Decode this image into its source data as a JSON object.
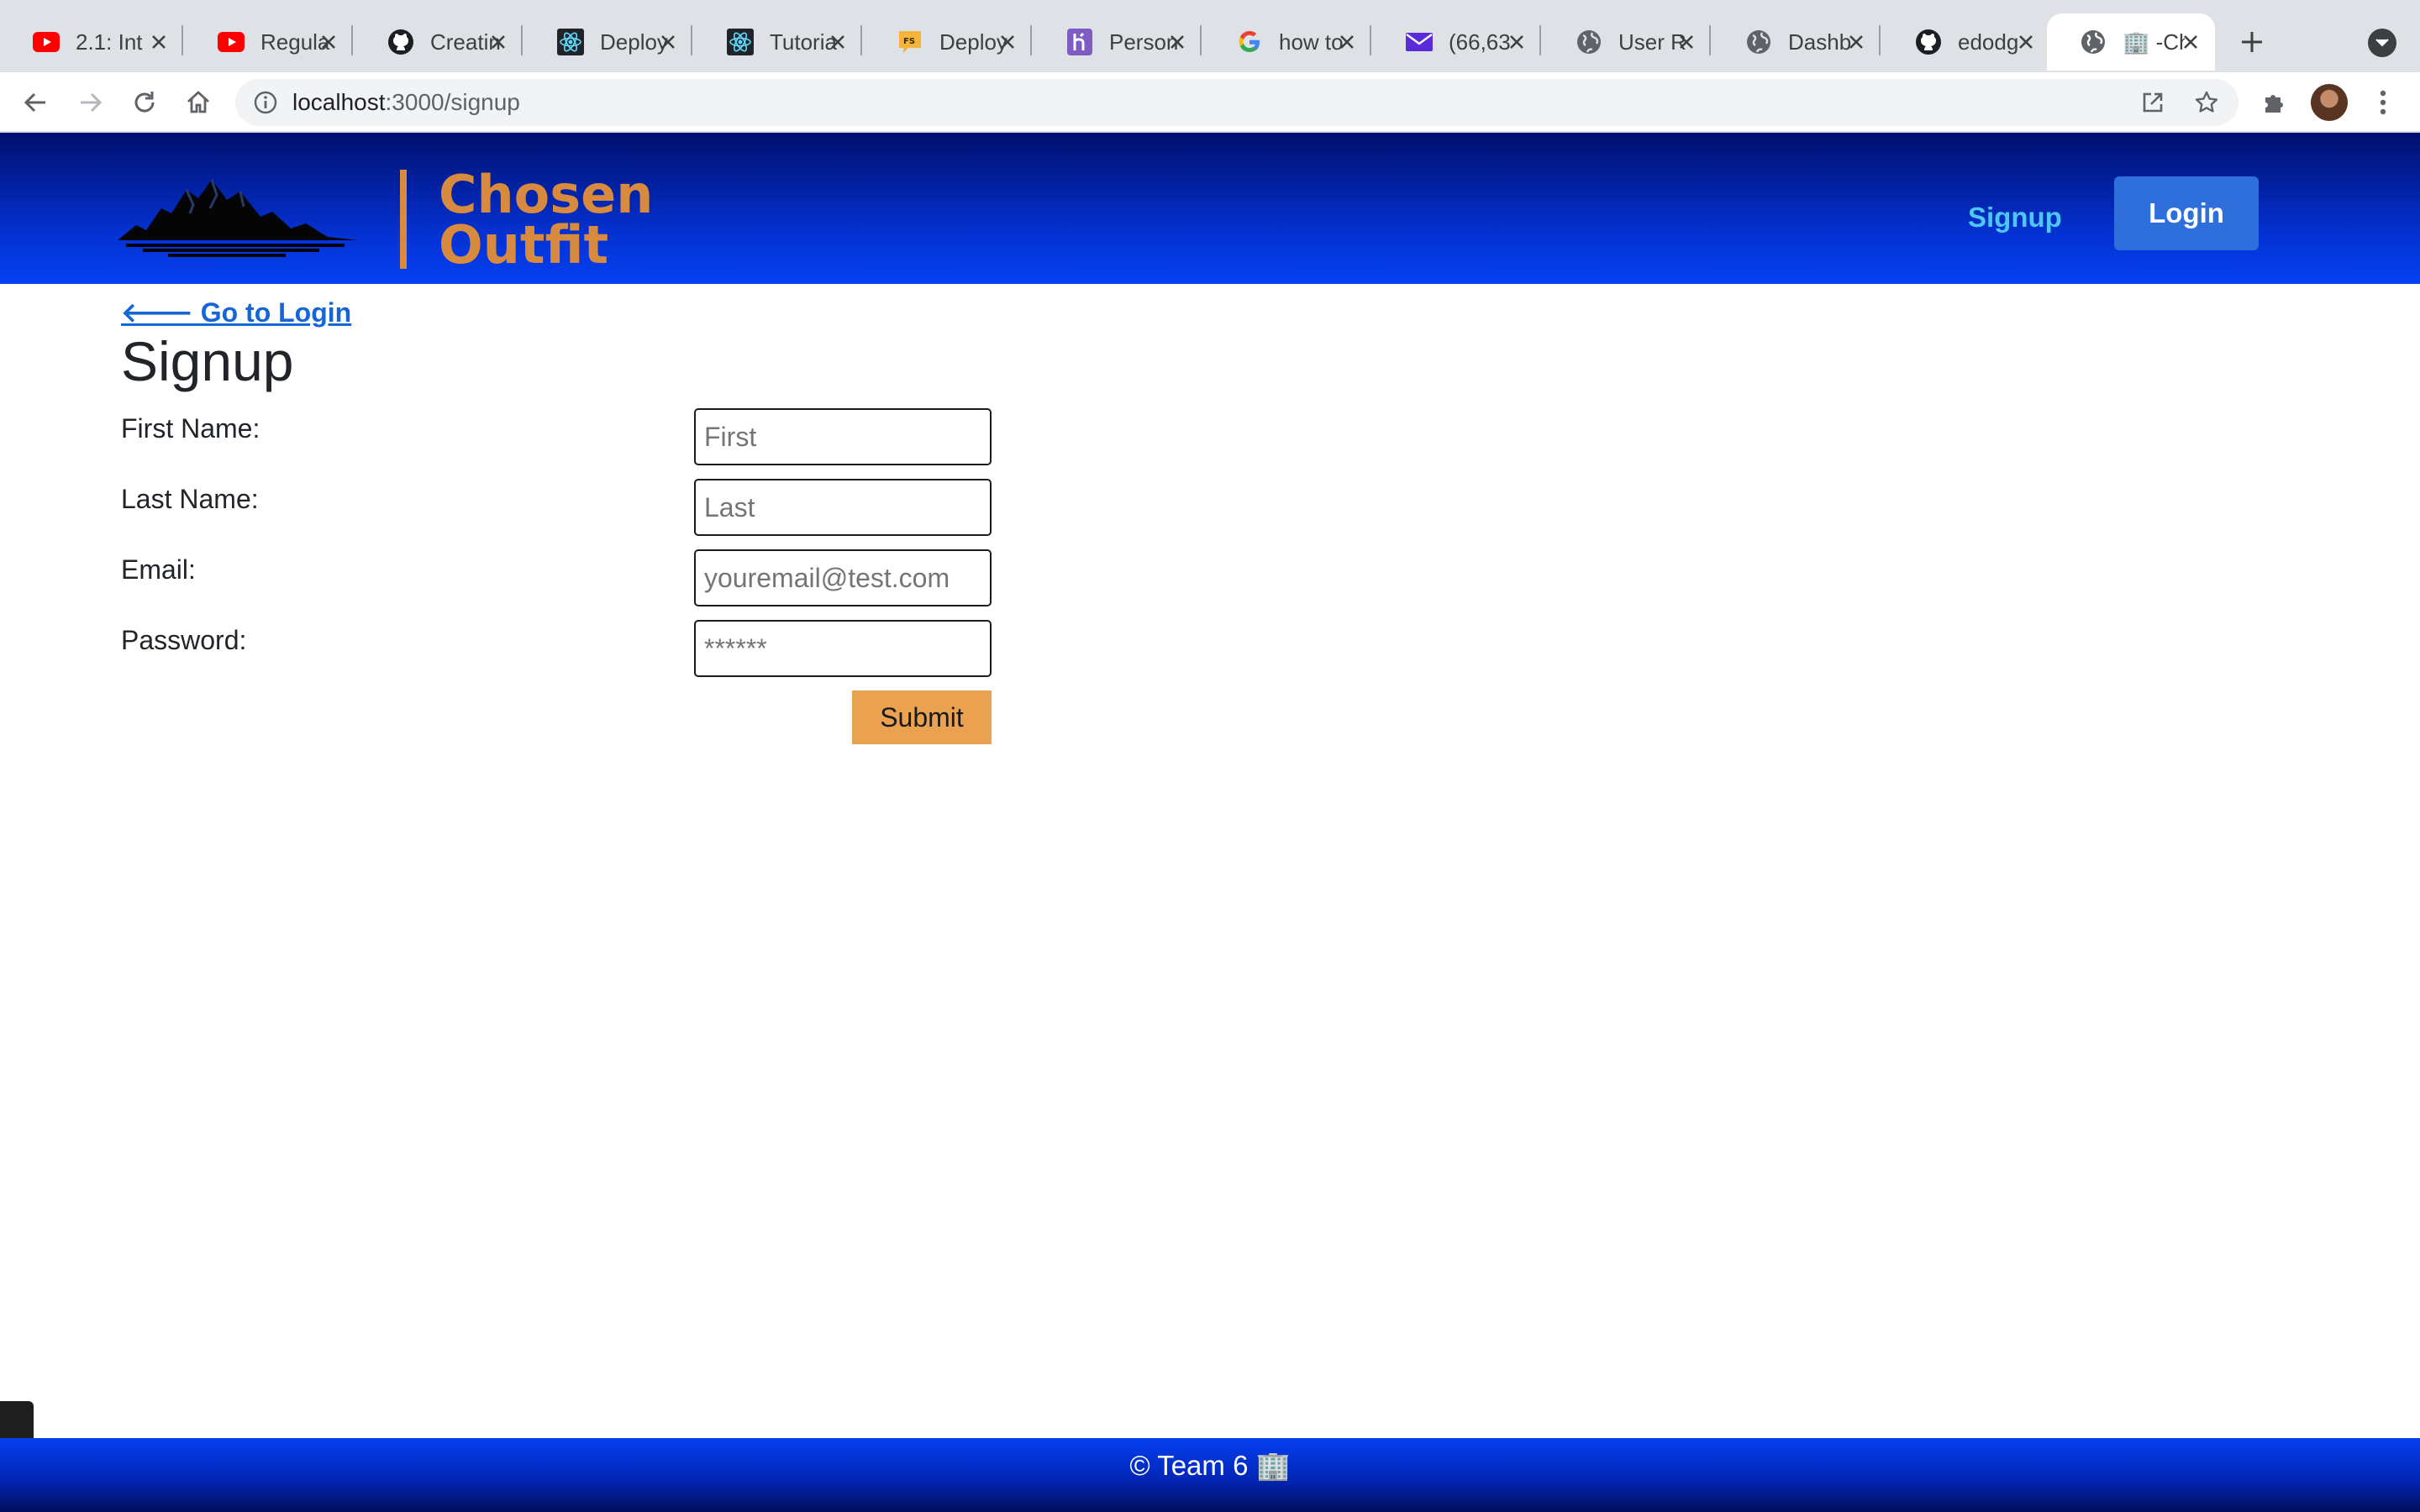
{
  "browser": {
    "tabs": [
      {
        "title": "2.1: Int",
        "icon": "youtube-icon"
      },
      {
        "title": "Regula",
        "icon": "youtube-icon"
      },
      {
        "title": "Creatin",
        "icon": "github-icon"
      },
      {
        "title": "Deploy",
        "icon": "react-icon"
      },
      {
        "title": "Tutoria",
        "icon": "react-icon"
      },
      {
        "title": "Deploy",
        "icon": "fullstack-icon"
      },
      {
        "title": "Person",
        "icon": "heroku-icon"
      },
      {
        "title": "how to",
        "icon": "google-icon"
      },
      {
        "title": "(66,63",
        "icon": "mail-icon"
      },
      {
        "title": "User R",
        "icon": "globe-icon"
      },
      {
        "title": "Dashb",
        "icon": "globe-icon"
      },
      {
        "title": "edodg",
        "icon": "github-icon"
      },
      {
        "title": "🏢 -Ch",
        "icon": "globe-icon"
      }
    ],
    "address": {
      "host": "localhost",
      "path": ":3000/signup"
    }
  },
  "header": {
    "logo_line1": "Chosen",
    "logo_line2": "Outfit",
    "nav_signup": "Signup",
    "nav_login": "Login",
    "colors": {
      "header_dark": "#000f6e",
      "header_light": "#0540f0",
      "logo_orange": "#d88a3e",
      "login_button": "#2e6fdc"
    }
  },
  "page": {
    "back_link": "🡐 Go to Login",
    "title": "Signup",
    "form": {
      "first_label": "First Name:",
      "first_placeholder": "First",
      "last_label": "Last Name:",
      "last_placeholder": "Last",
      "email_label": "Email:",
      "email_placeholder": "youremail@test.com",
      "password_label": "Password:",
      "password_placeholder": "******",
      "submit_label": "Submit",
      "submit_color": "#eaa250"
    }
  },
  "footer": {
    "text": "© Team 6 🏢"
  }
}
